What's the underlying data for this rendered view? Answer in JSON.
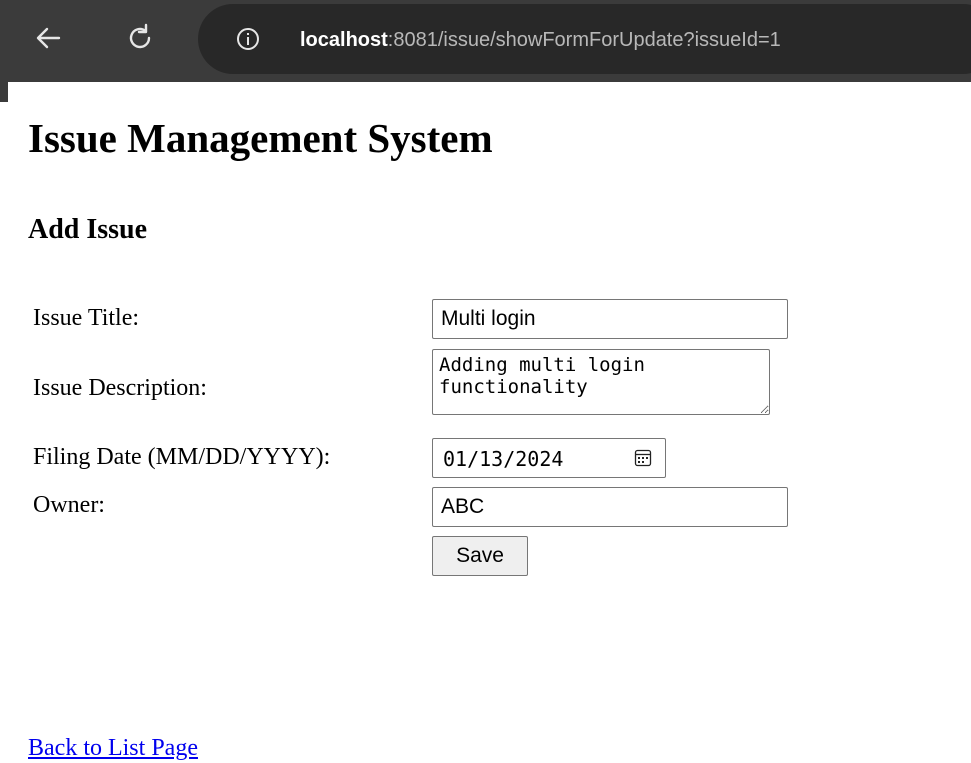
{
  "browser": {
    "url_host": "localhost",
    "url_path": ":8081/issue/showFormForUpdate?issueId=1"
  },
  "page": {
    "title": "Issue Management System",
    "subtitle": "Add Issue"
  },
  "form": {
    "issue_title": {
      "label": "Issue Title:",
      "value": "Multi login"
    },
    "issue_description": {
      "label": "Issue Description:",
      "value": "Adding multi login functionality"
    },
    "filing_date": {
      "label": "Filing Date (MM/DD/YYYY):",
      "value": "01/13/2024"
    },
    "owner": {
      "label": "Owner:",
      "value": "ABC"
    },
    "save_label": "Save"
  },
  "footer": {
    "back_link": "Back to List Page"
  },
  "colors": {
    "chrome_bg": "#3b3b3b",
    "omnibox_bg": "#282828",
    "link": "#0000ee"
  }
}
